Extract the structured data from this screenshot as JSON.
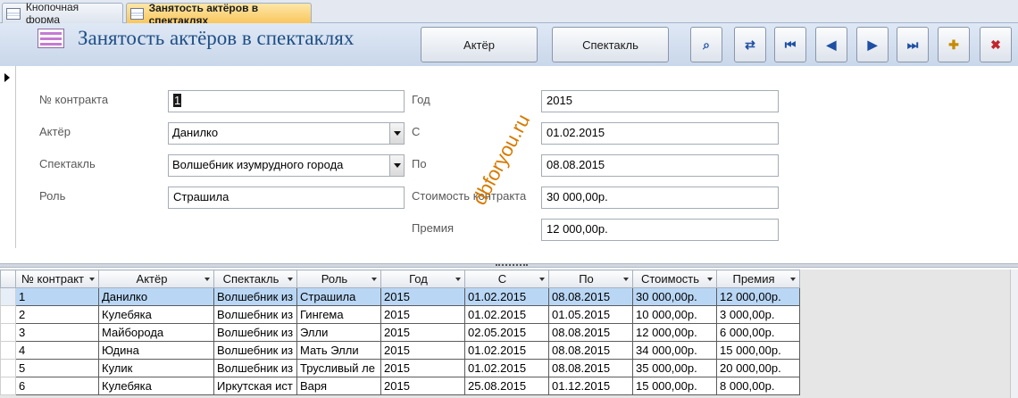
{
  "tabs": [
    {
      "label": "Кнопочная форма",
      "active": false
    },
    {
      "label": "Занятость актёров в спектаклях",
      "active": true
    }
  ],
  "header": {
    "title": "Занятость актёров в спектаклях",
    "buttons": {
      "actor": "Актёр",
      "play": "Спектакль"
    },
    "nav_icons": [
      "find-icon",
      "find-replace-icon",
      "first-record-icon",
      "previous-record-icon",
      "next-record-icon",
      "last-record-icon",
      "new-record-icon",
      "delete-record-icon"
    ]
  },
  "form": {
    "labels": {
      "contract": "№ контракта",
      "actor": "Актёр",
      "play": "Спектакль",
      "role": "Роль",
      "year": "Год",
      "from": "С",
      "to": "По",
      "cost": "Стоимость контракта",
      "bonus": "Премия"
    },
    "values": {
      "contract": "1",
      "actor": "Данилко",
      "play": "Волшебник изумрудного города",
      "role": "Страшила",
      "year": "2015",
      "from": "01.02.2015",
      "to": "08.08.2015",
      "cost": "30 000,00р.",
      "bonus": "12 000,00р."
    }
  },
  "watermark": "dbforyou.ru",
  "table": {
    "headers": [
      "№ контракт",
      "Актёр",
      "Спектакль",
      "Роль",
      "Год",
      "С",
      "По",
      "Стоимость",
      "Премия"
    ],
    "rows": [
      [
        "1",
        "Данилко",
        "Волшебник из",
        "Страшила",
        "2015",
        "01.02.2015",
        "08.08.2015",
        "30 000,00р.",
        "12 000,00р."
      ],
      [
        "2",
        "Кулебяка",
        "Волшебник из",
        "Гингема",
        "2015",
        "01.02.2015",
        "01.05.2015",
        "10 000,00р.",
        "3 000,00р."
      ],
      [
        "3",
        "Майборода",
        "Волшебник из",
        "Элли",
        "2015",
        "02.05.2015",
        "08.08.2015",
        "12 000,00р.",
        "6 000,00р."
      ],
      [
        "4",
        "Юдина",
        "Волшебник из",
        "Мать Элли",
        "2015",
        "01.02.2015",
        "08.08.2015",
        "34 000,00р.",
        "15 000,00р."
      ],
      [
        "5",
        "Кулик",
        "Волшебник из",
        "Трусливый ле",
        "2015",
        "01.02.2015",
        "08.08.2015",
        "35 000,00р.",
        "20 000,00р."
      ],
      [
        "6",
        "Кулебяка",
        "Иркутская ист",
        "Варя",
        "2015",
        "25.08.2015",
        "01.12.2015",
        "15 000,00р.",
        "8 000,00р."
      ]
    ]
  }
}
